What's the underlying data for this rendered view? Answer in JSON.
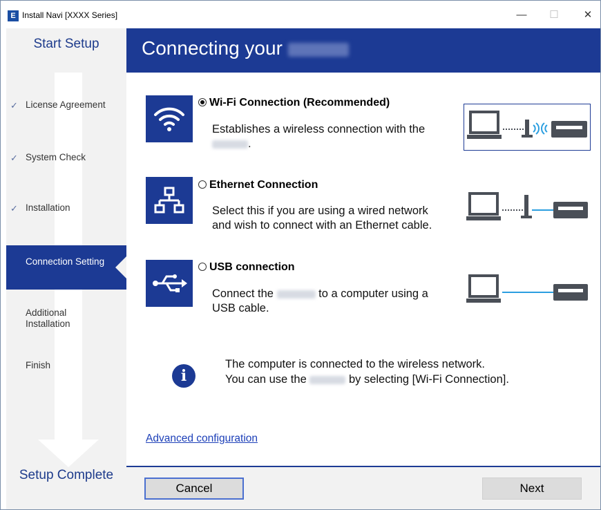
{
  "window": {
    "title": "Install Navi [XXXX Series]",
    "app_icon": "E",
    "controls": {
      "minimize": "—",
      "maximize": "☐",
      "close": "✕"
    }
  },
  "sidebar": {
    "start": "Start Setup",
    "steps": [
      {
        "label": "License Agreement",
        "done": true
      },
      {
        "label": "System Check",
        "done": true
      },
      {
        "label": "Installation",
        "done": true
      },
      {
        "label": "Connection Setting",
        "active": true
      },
      {
        "label_line1": "Additional",
        "label_line2": "Installation"
      },
      {
        "label": "Finish"
      }
    ],
    "check_glyph": "✓",
    "complete": "Setup Complete"
  },
  "header": {
    "title": "Connecting your"
  },
  "options": [
    {
      "id": "wifi",
      "title": "Wi-Fi Connection (Recommended)",
      "selected": true,
      "desc_line1": "Establishes a wireless connection with the",
      "desc_line2_suffix": ".",
      "icon": "wifi-icon"
    },
    {
      "id": "ethernet",
      "title": "Ethernet Connection",
      "selected": false,
      "desc_line1": "Select this if you are using a wired network",
      "desc_line2": "and wish to connect with an Ethernet cable.",
      "icon": "network-icon"
    },
    {
      "id": "usb",
      "title": "USB connection",
      "selected": false,
      "desc_line1_pre": "Connect the",
      "desc_line1_post": "to a computer using a",
      "desc_line2": "USB cable.",
      "icon": "usb-icon"
    }
  ],
  "info": {
    "icon": "info-icon",
    "glyph": "i",
    "line1": "The computer is connected to the wireless network.",
    "line2_pre": "You can use the",
    "line2_post": "by selecting [Wi-Fi Connection]."
  },
  "advanced_link": "Advanced configuration",
  "buttons": {
    "cancel": "Cancel",
    "next": "Next"
  },
  "colors": {
    "brand_blue": "#1c3a94",
    "sidebar_bg": "#f2f2f2",
    "link": "#1c3fb8"
  }
}
